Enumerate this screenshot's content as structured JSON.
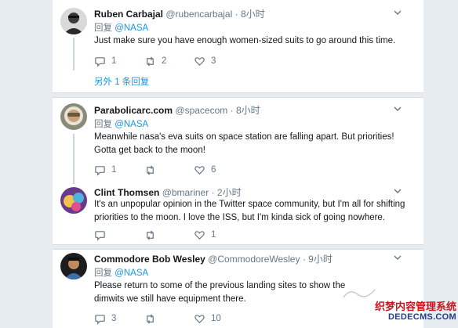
{
  "tweets": [
    {
      "name": "Ruben Carbajal",
      "handle": "@rubencarbajal",
      "time": "· 8小时",
      "reply_prefix": "回复 ",
      "reply_mention": "@NASA",
      "text": "Just make sure you have enough women-sized suits to go around this time.",
      "replies": "1",
      "retweets": "2",
      "likes": "3",
      "more_replies": "另外 1 条回复"
    },
    {
      "name": "Parabolicarc.com",
      "handle": "@spacecom",
      "time": "· 8小时",
      "reply_prefix": "回复 ",
      "reply_mention": "@NASA",
      "text": "Meanwhile nasa's eva suits on space station are falling apart. But priorities! Gotta get back to the moon!",
      "replies": "1",
      "retweets": "",
      "likes": "6"
    },
    {
      "name": "Clint Thomsen",
      "handle": "@bmariner",
      "time": "· 2小时",
      "text": "It's an unpopular opinion in the Twitter space community, but I'm all for shifting priorities to the moon. I love the ISS, but I'm kinda sick of going nowhere.",
      "replies": "",
      "retweets": "",
      "likes": "1"
    },
    {
      "name": "Commodore Bob Wesley",
      "handle": "@CommodoreWesley",
      "time": "· 9小时",
      "reply_prefix": "回复 ",
      "reply_mention": "@NASA",
      "text": "Please return to some of the previous landing sites to show the dimwits we still have equipment there.",
      "replies": "3",
      "retweets": "",
      "likes": "10"
    }
  ],
  "watermark": {
    "line1": "织梦内容管理系统",
    "line2": "DEDECMS.COM"
  },
  "colors": {
    "accent": "#1b95e0",
    "muted": "#657786",
    "text": "#14171a",
    "background": "#e6ecf0"
  }
}
